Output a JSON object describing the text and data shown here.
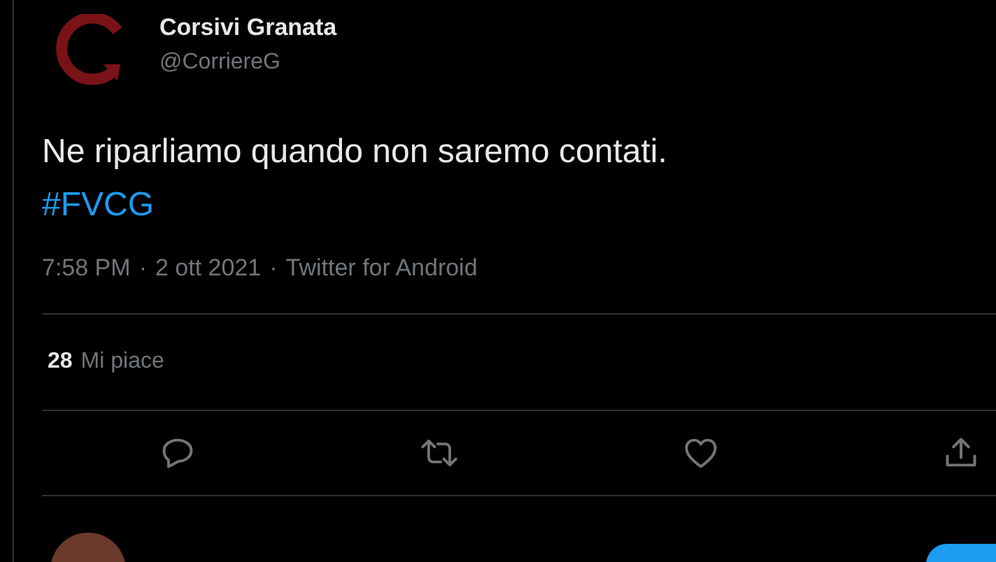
{
  "author": {
    "name": "Corsivi Granata",
    "handle": "@CorriereG"
  },
  "tweet": {
    "text": "Ne riparliamo quando non saremo contati.",
    "hashtag": "#FVCG"
  },
  "meta": {
    "time": "7:58 PM",
    "separator_1": "·",
    "date": "2 ott 2021",
    "separator_2": "·",
    "source": "Twitter for Android"
  },
  "likes": {
    "count": "28",
    "label": "Mi piace"
  }
}
